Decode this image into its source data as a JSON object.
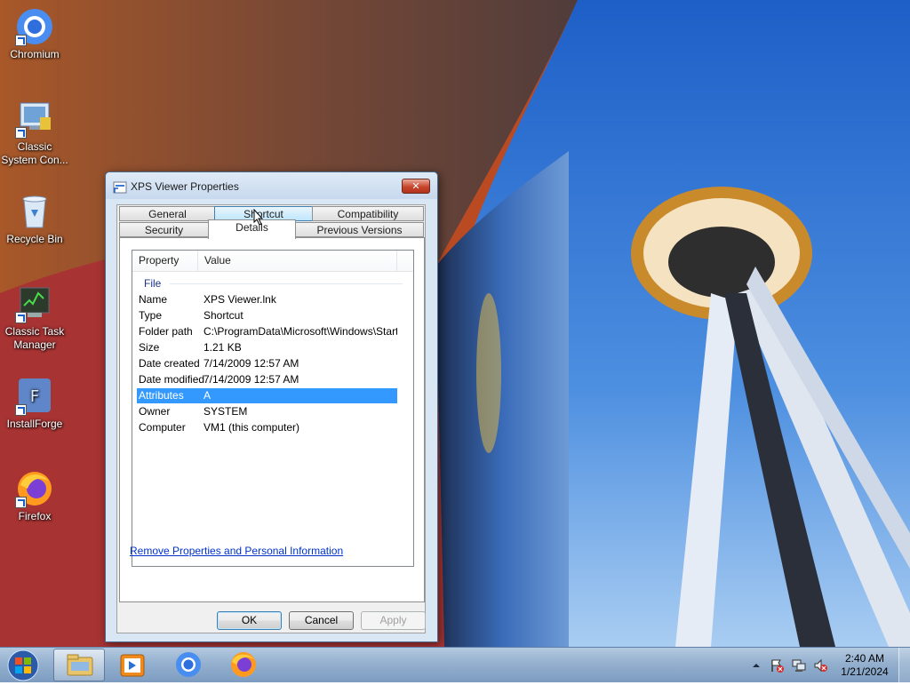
{
  "desktop": {
    "icons": [
      {
        "label": "Chromium",
        "icon": "chromium-icon"
      },
      {
        "label": "Classic System Con...",
        "icon": "control-panel-icon"
      },
      {
        "label": "Recycle Bin",
        "icon": "recycle-bin-icon"
      },
      {
        "label": "Classic Task Manager",
        "icon": "task-manager-icon"
      },
      {
        "label": "InstallForge",
        "icon": "installforge-icon"
      },
      {
        "label": "Firefox",
        "icon": "firefox-icon"
      }
    ]
  },
  "dialog": {
    "title": "XPS Viewer Properties",
    "close_symbol": "✕",
    "tabs_row1": [
      "General",
      "Shortcut",
      "Compatibility"
    ],
    "tabs_row2": [
      "Security",
      "Details",
      "Previous Versions"
    ],
    "active_tab": "Details",
    "columns": [
      "Property",
      "Value"
    ],
    "group": "File",
    "rows": [
      {
        "property": "Name",
        "value": "XPS Viewer.lnk"
      },
      {
        "property": "Type",
        "value": "Shortcut"
      },
      {
        "property": "Folder path",
        "value": "C:\\ProgramData\\Microsoft\\Windows\\Start..."
      },
      {
        "property": "Size",
        "value": "1.21 KB"
      },
      {
        "property": "Date created",
        "value": "7/14/2009 12:57 AM"
      },
      {
        "property": "Date modified",
        "value": "7/14/2009 12:57 AM"
      },
      {
        "property": "Attributes",
        "value": "A",
        "selected": true
      },
      {
        "property": "Owner",
        "value": "SYSTEM"
      },
      {
        "property": "Computer",
        "value": "VM1 (this computer)"
      }
    ],
    "link": "Remove Properties and Personal Information",
    "buttons": {
      "ok": "OK",
      "cancel": "Cancel",
      "apply": "Apply"
    }
  },
  "taskbar": {
    "pinned": [
      "file-explorer-icon",
      "media-player-icon",
      "chromium-icon",
      "firefox-icon"
    ],
    "tray": [
      "show-hidden-icons-icon",
      "action-center-icon",
      "network-icon",
      "volume-muted-icon"
    ],
    "time": "2:40 AM",
    "date": "1/21/2024"
  },
  "colors": {
    "selection": "#3399ff",
    "link": "#0033cc",
    "sky": "#2d6fd0"
  }
}
